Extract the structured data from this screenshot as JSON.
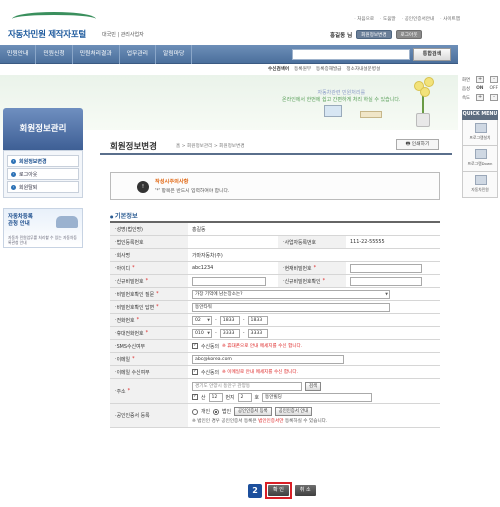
{
  "header": {
    "logo_text": "자동차민원 제작자포털",
    "sub_links": [
      "대국민",
      "관리사업자"
    ],
    "util_links": [
      "처음으로",
      "도움말",
      "공인인증서안내",
      "사이트맵"
    ],
    "user_name": "홍길동 님",
    "btn_edit": "회원정보변경",
    "btn_logout": "로그아웃"
  },
  "gnb": {
    "items": [
      "민원안내",
      "민원신청",
      "민원처리결과",
      "업무관리",
      "알림마당"
    ],
    "search_button": "통합검색"
  },
  "subbar": {
    "label": "수신검색어",
    "links": [
      "등록원부",
      "등록증재발급",
      "정소자내설문병설"
    ]
  },
  "banner": {
    "line1": "자동차관련 민원처리를",
    "line2": "온라인에서 한번에 쉽고 간편하게 처리 하실 수 있습니다."
  },
  "lnb": {
    "title": "회원정보관리",
    "items": [
      "회원정보변경",
      "로그아웃",
      "회원탈퇴"
    ],
    "promo_title_1": "자동차등록",
    "promo_title_2": "관청 안내",
    "promo_desc": "자동차 민원업무를 처리할 수 있는 자동차등록관청 안내"
  },
  "quick": {
    "zoom_label": "화면",
    "sound_label": "음성",
    "sound_state": "ON",
    "sound_off": "OFF",
    "speed_label": "속도",
    "plus": "+",
    "minus": "-",
    "title": "QUICK MENU",
    "items": [
      "프로그램설치",
      "프로그램Down",
      "자동차민원"
    ]
  },
  "content": {
    "page_title": "회원정보변경",
    "breadcrumb": "홈 > 회원정보관리 > 회원정보변경",
    "print": "인쇄하기",
    "notice_title": "작성시주의사항",
    "notice_text": "'*' 항목은 반드시 입력하여야 합니다.",
    "section_title": "기본정보"
  },
  "form": {
    "labels": {
      "name": "성명(법인명)",
      "corp_no": "법인등록번호",
      "biz_no": "사업자등록번호",
      "company": "회사명",
      "id": "아이디",
      "cur_pw": "현재비밀번호",
      "new_pw": "신규비밀번호",
      "new_pw_confirm": "신규비밀번호확인",
      "pw_question": "비밀번호확인 질문",
      "pw_answer": "비밀번호확인 답변",
      "phone": "전화번호",
      "mobile": "휴대전화번호",
      "sms": "SMS수신여부",
      "email": "이메일",
      "email_recv": "이메일 수신여부",
      "address": "주소",
      "cert": "공인인증서 등록"
    },
    "values": {
      "name": "홍길동",
      "biz_no": "111-22-55555",
      "company": "가마자동차(주)",
      "id": "abc1234",
      "pw_question": "가장 기억에 남는장소는?",
      "pw_answer": "동안타워",
      "phone": [
        "02",
        "1833",
        "1833"
      ],
      "mobile": [
        "010",
        "3333",
        "3333"
      ],
      "sms_agree": "수신동의",
      "sms_note": "※ 휴대폰으로 안내 메세지를 수신 합니다.",
      "email": "abc@korea.com",
      "email_agree": "수신동의",
      "email_note": "※ 이메일로 안내 메세지를 수신 합니다.",
      "addr_line1": "경기도 안양시 동안구 관양동",
      "addr_search": "검색",
      "addr_sanlabel": "산",
      "addr_bunji": "12",
      "addr_bunji_label": "번지",
      "addr_ho": "2",
      "addr_ho_label": "호",
      "addr_detail": "동안빌딩",
      "cert_personal": "개인",
      "cert_corp": "법인",
      "cert_btn1": "공인인증서 등록",
      "cert_btn2": "공인인증서 안내",
      "cert_note_pre": "※ 법인인 경우 공인인증서 등록은",
      "cert_note_mid": "법인인증서만",
      "cert_note_post": "등록하실 수 있습니다."
    },
    "required_mark": "*"
  },
  "buttons": {
    "step": "2",
    "ok": "확 인",
    "cancel": "취 소"
  }
}
